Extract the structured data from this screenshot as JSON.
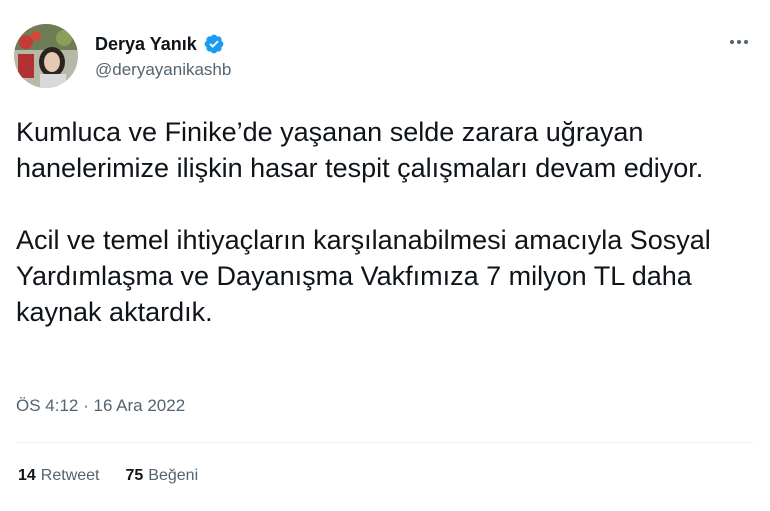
{
  "author": {
    "display_name": "Derya Yanık",
    "handle": "@deryayanikashb",
    "verified": true,
    "avatar_icon": "profile-photo",
    "verified_color": "#1d9bf0"
  },
  "tweet": {
    "paragraphs": [
      "Kumluca ve Finike’de yaşanan selde zarara uğrayan hanelerimize ilişkin hasar tespit çalışmaları devam ediyor.",
      "Acil ve temel ihtiyaçların karşılanabilmesi amacıyla Sosyal Yardımlaşma ve Dayanışma Vakfımıza 7 milyon TL daha kaynak aktardık."
    ],
    "time": "ÖS 4:12",
    "separator": " · ",
    "date": "16 Ara 2022"
  },
  "stats": {
    "retweets_count": "14",
    "retweets_label": "Retweet",
    "likes_count": "75",
    "likes_label": "Beğeni"
  },
  "icons": {
    "more": "more-options-icon",
    "verified": "verified-badge-icon"
  }
}
